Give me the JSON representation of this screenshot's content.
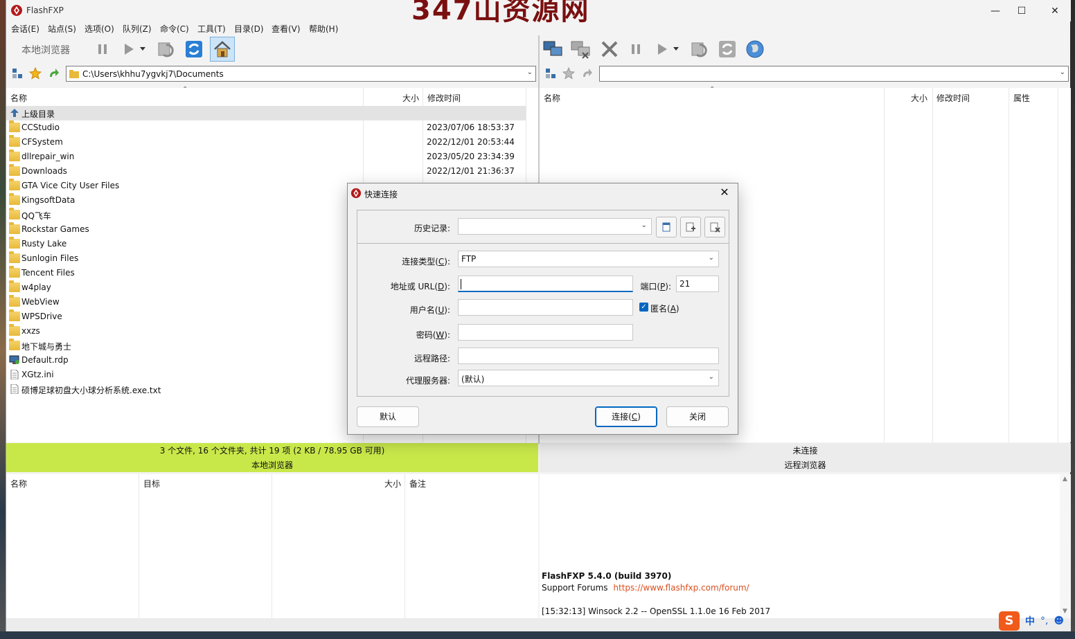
{
  "window": {
    "title": "FlashFXP",
    "watermark": "347山资源网"
  },
  "menu": [
    "会话(E)",
    "站点(S)",
    "选项(O)",
    "队列(Z)",
    "命令(C)",
    "工具(T)",
    "目录(D)",
    "查看(V)",
    "帮助(H)"
  ],
  "local": {
    "toolbar_label": "本地浏览器",
    "path": "C:\\Users\\khhu7ygvkj7\\Documents",
    "columns": {
      "name": "名称",
      "size": "大小",
      "modified": "修改时间"
    },
    "parent": "上级目录",
    "rows": [
      {
        "name": "CCStudio",
        "date": "2023/07/06 18:53:37",
        "type": "folder"
      },
      {
        "name": "CFSystem",
        "date": "2022/12/01 20:53:44",
        "type": "folder"
      },
      {
        "name": "dllrepair_win",
        "date": "2023/05/20 23:34:39",
        "type": "folder"
      },
      {
        "name": "Downloads",
        "date": "2022/12/01 21:36:37",
        "type": "folder"
      },
      {
        "name": "GTA Vice City User Files",
        "date": "",
        "type": "folder"
      },
      {
        "name": "KingsoftData",
        "date": "",
        "type": "folder"
      },
      {
        "name": "QQ飞车",
        "date": "",
        "type": "folder"
      },
      {
        "name": "Rockstar Games",
        "date": "",
        "type": "folder"
      },
      {
        "name": "Rusty Lake",
        "date": "",
        "type": "folder"
      },
      {
        "name": "Sunlogin Files",
        "date": "",
        "type": "folder"
      },
      {
        "name": "Tencent Files",
        "date": "",
        "type": "folder"
      },
      {
        "name": "w4play",
        "date": "",
        "type": "folder"
      },
      {
        "name": "WebView",
        "date": "",
        "type": "folder"
      },
      {
        "name": "WPSDrive",
        "date": "",
        "type": "folder"
      },
      {
        "name": "xxzs",
        "date": "",
        "type": "folder"
      },
      {
        "name": "地下城与勇士",
        "date": "",
        "type": "folder"
      },
      {
        "name": "Default.rdp",
        "date": "",
        "type": "rdp"
      },
      {
        "name": "XGtz.ini",
        "date": "",
        "type": "file"
      },
      {
        "name": "硕博足球初盘大小球分析系统.exe.txt",
        "date": "",
        "type": "file"
      }
    ],
    "status_line1": "3 个文件, 16 个文件夹, 共计 19 项 (2 KB / 78.95 GB 可用)",
    "status_line2": "本地浏览器"
  },
  "remote": {
    "columns": {
      "name": "名称",
      "size": "大小",
      "modified": "修改时间",
      "attr": "属性"
    },
    "status_line1": "未连接",
    "status_line2": "远程浏览器"
  },
  "queue": {
    "columns": {
      "name": "名称",
      "target": "目标",
      "size": "大小",
      "note": "备注"
    }
  },
  "log": {
    "version": "FlashFXP 5.4.0 (build 3970)",
    "support_label": "Support Forums",
    "support_url": "https://www.flashfxp.com/forum/",
    "winsock": "[15:32:13]  Winsock 2.2 -- OpenSSL 1.1.0e  16 Feb 2017"
  },
  "dialog": {
    "title": "快速连接",
    "history_label": "历史记录:",
    "conn_type_label": "连接类型(C):",
    "conn_type_value": "FTP",
    "address_label": "地址或 URL(D):",
    "address_value": "",
    "port_label": "端口(P):",
    "port_value": "21",
    "user_label": "用户名(U):",
    "anonymous_label": "匿名(A)",
    "anonymous_checked": true,
    "password_label": "密码(W):",
    "remote_path_label": "远程路径:",
    "proxy_label": "代理服务器:",
    "proxy_value": "(默认)",
    "btn_default": "默认",
    "btn_connect": "连接(C)",
    "btn_close": "关闭"
  },
  "ime": {
    "lang": "中"
  }
}
